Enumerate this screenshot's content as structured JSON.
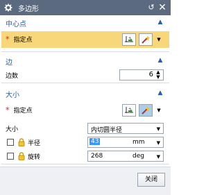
{
  "window": {
    "title": "多边形",
    "reset_icon": "reset-icon",
    "close_icon": "close-icon"
  },
  "center": {
    "title": "中心点",
    "specify_point_label": "指定点",
    "required_mark": "*"
  },
  "sides": {
    "title": "边",
    "count_label": "边数",
    "count_value": "6"
  },
  "size": {
    "title": "大小",
    "specify_point_label": "指定点",
    "required_mark": "*",
    "size_label": "大小",
    "size_option": "内切圆半径",
    "radius_label": "半径",
    "radius_value": "43",
    "radius_unit": "mm",
    "rotation_label": "旋转",
    "rotation_value": "268",
    "rotation_unit": "deg"
  },
  "footer": {
    "close_label": "关闭"
  },
  "colors": {
    "titlebar": "#5b6a7f",
    "section_title": "#2a5ea8",
    "highlight_row": "#f7d77a",
    "selection": "#3399ff"
  }
}
